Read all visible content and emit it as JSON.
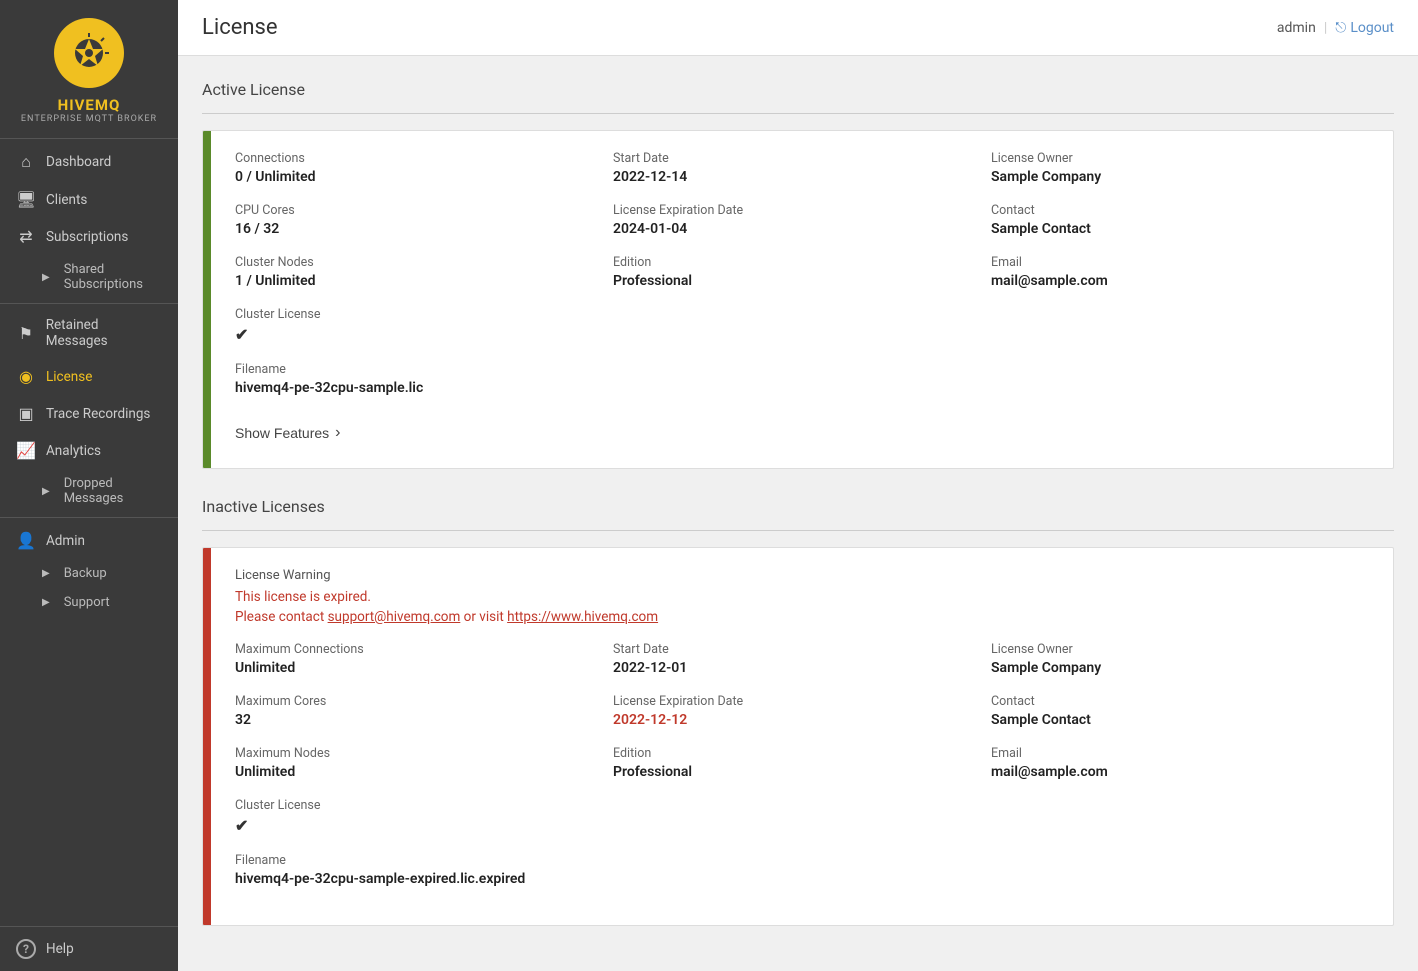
{
  "sidebar": {
    "brand_name": "HIVEMQ",
    "brand_sub": "ENTERPRISE MQTT BROKER",
    "nav_items": [
      {
        "id": "dashboard",
        "label": "Dashboard",
        "icon": "⌂",
        "active": false
      },
      {
        "id": "clients",
        "label": "Clients",
        "icon": "🖥",
        "active": false
      },
      {
        "id": "subscriptions",
        "label": "Subscriptions",
        "icon": "⇄",
        "active": false
      },
      {
        "id": "shared-subscriptions",
        "label": "Shared Subscriptions",
        "sub": true
      },
      {
        "id": "retained-messages",
        "label": "Retained Messages",
        "icon": "⚑",
        "active": false
      },
      {
        "id": "license",
        "label": "License",
        "icon": "👤",
        "active": true
      },
      {
        "id": "trace-recordings",
        "label": "Trace Recordings",
        "icon": "🖼",
        "active": false
      },
      {
        "id": "analytics",
        "label": "Analytics",
        "icon": "📈",
        "active": false
      },
      {
        "id": "dropped-messages",
        "label": "Dropped Messages",
        "sub": true
      },
      {
        "id": "admin",
        "label": "Admin",
        "icon": "👤",
        "active": false
      },
      {
        "id": "backup",
        "label": "Backup",
        "sub": true
      },
      {
        "id": "support",
        "label": "Support",
        "sub": true
      }
    ],
    "help_label": "Help"
  },
  "topbar": {
    "title": "License",
    "user": "admin",
    "logout_label": "Logout"
  },
  "active_license": {
    "section_title": "Active License",
    "connections_label": "Connections",
    "connections_value": "0 / Unlimited",
    "start_date_label": "Start Date",
    "start_date_value": "2022-12-14",
    "license_owner_label": "License Owner",
    "license_owner_value": "Sample Company",
    "cpu_cores_label": "CPU Cores",
    "cpu_cores_value": "16 / 32",
    "expiration_label": "License Expiration Date",
    "expiration_value": "2024-01-04",
    "contact_label": "Contact",
    "contact_value": "Sample Contact",
    "cluster_nodes_label": "Cluster Nodes",
    "cluster_nodes_value": "1 / Unlimited",
    "edition_label": "Edition",
    "edition_value": "Professional",
    "email_label": "Email",
    "email_value": "mail@sample.com",
    "cluster_license_label": "Cluster License",
    "cluster_license_value": "✔",
    "filename_label": "Filename",
    "filename_value": "hivemq4-pe-32cpu-sample.lic",
    "show_features_label": "Show Features",
    "show_features_arrow": "›"
  },
  "inactive_license": {
    "section_title": "Inactive Licenses",
    "warning_label": "License Warning",
    "warning_line1": "This license is expired.",
    "warning_line2_prefix": "Please contact ",
    "warning_email": "support@hivemq.com",
    "warning_line2_mid": " or visit ",
    "warning_url": "https://www.hivemq.com",
    "max_connections_label": "Maximum Connections",
    "max_connections_value": "Unlimited",
    "start_date_label": "Start Date",
    "start_date_value": "2022-12-01",
    "license_owner_label": "License Owner",
    "license_owner_value": "Sample Company",
    "max_cores_label": "Maximum Cores",
    "max_cores_value": "32",
    "expiration_label": "License Expiration Date",
    "expiration_value": "2022-12-12",
    "contact_label": "Contact",
    "contact_value": "Sample Contact",
    "max_nodes_label": "Maximum Nodes",
    "max_nodes_value": "Unlimited",
    "edition_label": "Edition",
    "edition_value": "Professional",
    "email_label": "Email",
    "email_value": "mail@sample.com",
    "cluster_license_label": "Cluster License",
    "cluster_license_value": "✔",
    "filename_label": "Filename",
    "filename_value": "hivemq4-pe-32cpu-sample-expired.lic.expired"
  }
}
